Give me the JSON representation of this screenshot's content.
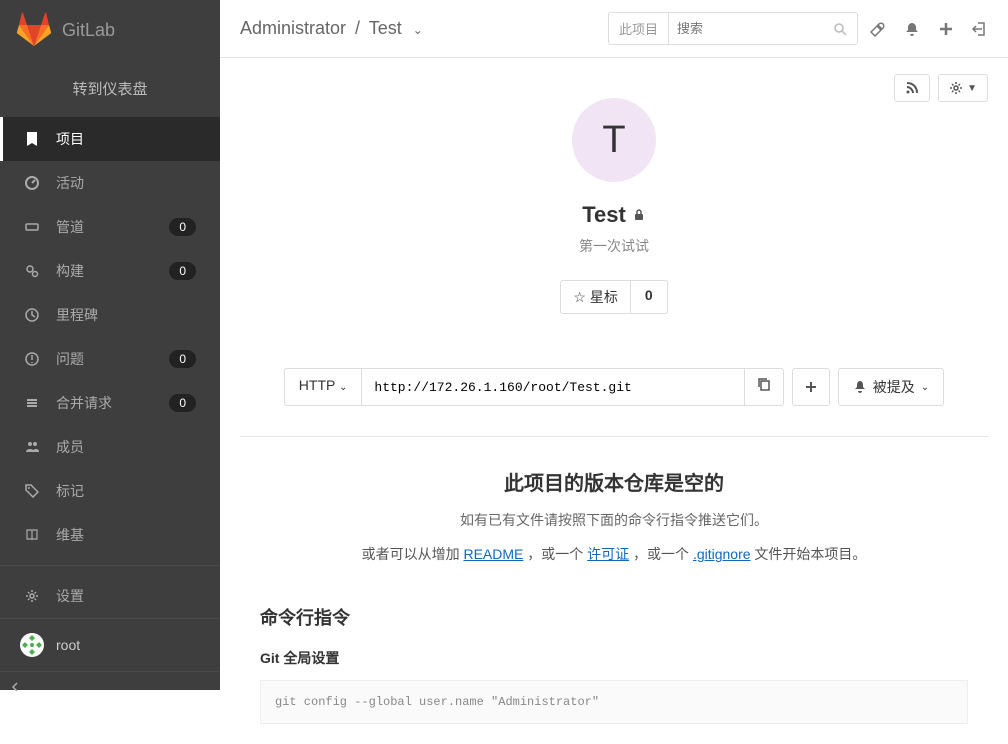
{
  "brand": "GitLab",
  "sidebar": {
    "dashboard": "转到仪表盘",
    "items": [
      {
        "label": "项目",
        "badge": null,
        "active": true,
        "icon": "bookmark"
      },
      {
        "label": "活动",
        "badge": null,
        "active": false,
        "icon": "dashboard"
      },
      {
        "label": "管道",
        "badge": "0",
        "active": false,
        "icon": "pipeline"
      },
      {
        "label": "构建",
        "badge": "0",
        "active": false,
        "icon": "gears"
      },
      {
        "label": "里程碑",
        "badge": null,
        "active": false,
        "icon": "clock"
      },
      {
        "label": "问题",
        "badge": "0",
        "active": false,
        "icon": "exclamation"
      },
      {
        "label": "合并请求",
        "badge": "0",
        "active": false,
        "icon": "merge"
      },
      {
        "label": "成员",
        "badge": null,
        "active": false,
        "icon": "users"
      },
      {
        "label": "标记",
        "badge": null,
        "active": false,
        "icon": "tags"
      },
      {
        "label": "维基",
        "badge": null,
        "active": false,
        "icon": "book"
      }
    ],
    "settings": "设置",
    "user": "root"
  },
  "topbar": {
    "breadcrumb_owner": "Administrator",
    "breadcrumb_project": "Test",
    "search_scope": "此项目",
    "search_placeholder": "搜索"
  },
  "project": {
    "initial": "T",
    "name": "Test",
    "description": "第一次试试",
    "star_label": "星标",
    "star_count": "0",
    "clone_protocol": "HTTP",
    "clone_url": "http://172.26.1.160/root/Test.git",
    "notification_label": "被提及"
  },
  "empty": {
    "title": "此项目的版本仓库是空的",
    "subtitle": "如有已有文件请按照下面的命令行指令推送它们。",
    "prefix": "或者可以从增加 ",
    "readme": "README",
    "mid1": " ，或一个 ",
    "license": "许可证",
    "mid2": " ，或一个 ",
    "gitignore": ".gitignore",
    "suffix": " 文件开始本项目。",
    "cmd_title": "命令行指令",
    "git_global": "Git 全局设置",
    "git_cmd": "git config --global user.name \"Administrator\""
  }
}
